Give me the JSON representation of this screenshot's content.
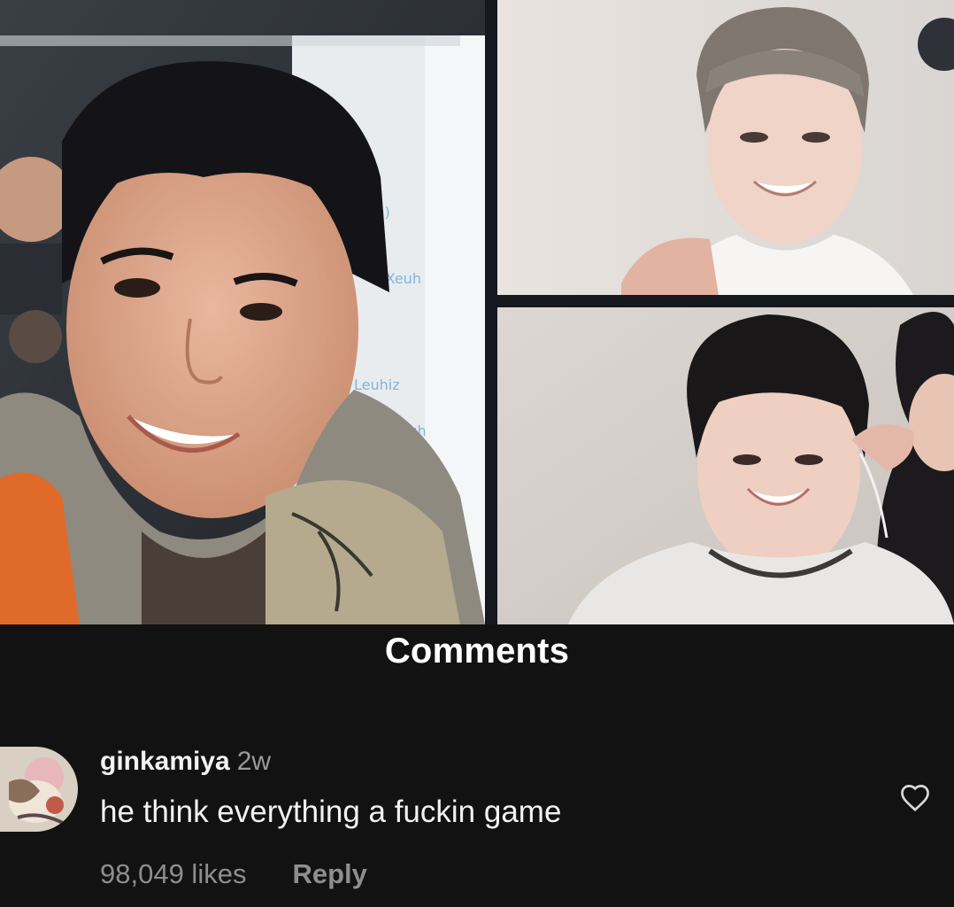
{
  "collage": {
    "photos": [
      {
        "name": "left-selfie-photo"
      },
      {
        "name": "top-right-photo"
      },
      {
        "name": "bottom-right-photo"
      }
    ]
  },
  "comments": {
    "title": "Comments",
    "items": [
      {
        "username": "ginkamiya",
        "time": "2w",
        "text": "he think everything a fuckin game",
        "likes": "98,049 likes",
        "reply_label": "Reply",
        "icons": {
          "avatar": "avatar",
          "like": "heart-outline-icon"
        }
      }
    ]
  },
  "colors": {
    "background": "#121212",
    "text_primary": "#f2f2f2",
    "text_secondary": "#8e8e8e"
  }
}
